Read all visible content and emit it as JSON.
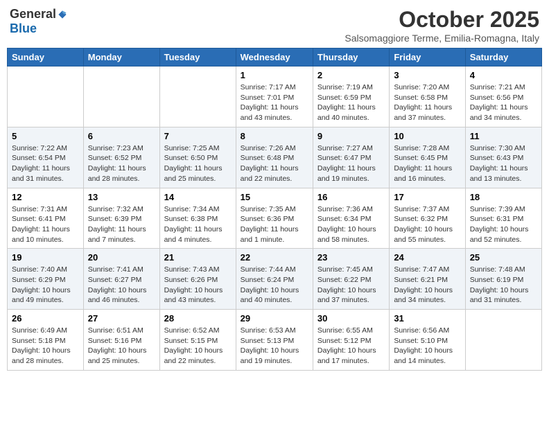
{
  "header": {
    "logo_general": "General",
    "logo_blue": "Blue",
    "month_year": "October 2025",
    "location": "Salsomaggiore Terme, Emilia-Romagna, Italy"
  },
  "days_of_week": [
    "Sunday",
    "Monday",
    "Tuesday",
    "Wednesday",
    "Thursday",
    "Friday",
    "Saturday"
  ],
  "weeks": [
    [
      {
        "day": "",
        "content": ""
      },
      {
        "day": "",
        "content": ""
      },
      {
        "day": "",
        "content": ""
      },
      {
        "day": "1",
        "content": "Sunrise: 7:17 AM\nSunset: 7:01 PM\nDaylight: 11 hours\nand 43 minutes."
      },
      {
        "day": "2",
        "content": "Sunrise: 7:19 AM\nSunset: 6:59 PM\nDaylight: 11 hours\nand 40 minutes."
      },
      {
        "day": "3",
        "content": "Sunrise: 7:20 AM\nSunset: 6:58 PM\nDaylight: 11 hours\nand 37 minutes."
      },
      {
        "day": "4",
        "content": "Sunrise: 7:21 AM\nSunset: 6:56 PM\nDaylight: 11 hours\nand 34 minutes."
      }
    ],
    [
      {
        "day": "5",
        "content": "Sunrise: 7:22 AM\nSunset: 6:54 PM\nDaylight: 11 hours\nand 31 minutes."
      },
      {
        "day": "6",
        "content": "Sunrise: 7:23 AM\nSunset: 6:52 PM\nDaylight: 11 hours\nand 28 minutes."
      },
      {
        "day": "7",
        "content": "Sunrise: 7:25 AM\nSunset: 6:50 PM\nDaylight: 11 hours\nand 25 minutes."
      },
      {
        "day": "8",
        "content": "Sunrise: 7:26 AM\nSunset: 6:48 PM\nDaylight: 11 hours\nand 22 minutes."
      },
      {
        "day": "9",
        "content": "Sunrise: 7:27 AM\nSunset: 6:47 PM\nDaylight: 11 hours\nand 19 minutes."
      },
      {
        "day": "10",
        "content": "Sunrise: 7:28 AM\nSunset: 6:45 PM\nDaylight: 11 hours\nand 16 minutes."
      },
      {
        "day": "11",
        "content": "Sunrise: 7:30 AM\nSunset: 6:43 PM\nDaylight: 11 hours\nand 13 minutes."
      }
    ],
    [
      {
        "day": "12",
        "content": "Sunrise: 7:31 AM\nSunset: 6:41 PM\nDaylight: 11 hours\nand 10 minutes."
      },
      {
        "day": "13",
        "content": "Sunrise: 7:32 AM\nSunset: 6:39 PM\nDaylight: 11 hours\nand 7 minutes."
      },
      {
        "day": "14",
        "content": "Sunrise: 7:34 AM\nSunset: 6:38 PM\nDaylight: 11 hours\nand 4 minutes."
      },
      {
        "day": "15",
        "content": "Sunrise: 7:35 AM\nSunset: 6:36 PM\nDaylight: 11 hours\nand 1 minute."
      },
      {
        "day": "16",
        "content": "Sunrise: 7:36 AM\nSunset: 6:34 PM\nDaylight: 10 hours\nand 58 minutes."
      },
      {
        "day": "17",
        "content": "Sunrise: 7:37 AM\nSunset: 6:32 PM\nDaylight: 10 hours\nand 55 minutes."
      },
      {
        "day": "18",
        "content": "Sunrise: 7:39 AM\nSunset: 6:31 PM\nDaylight: 10 hours\nand 52 minutes."
      }
    ],
    [
      {
        "day": "19",
        "content": "Sunrise: 7:40 AM\nSunset: 6:29 PM\nDaylight: 10 hours\nand 49 minutes."
      },
      {
        "day": "20",
        "content": "Sunrise: 7:41 AM\nSunset: 6:27 PM\nDaylight: 10 hours\nand 46 minutes."
      },
      {
        "day": "21",
        "content": "Sunrise: 7:43 AM\nSunset: 6:26 PM\nDaylight: 10 hours\nand 43 minutes."
      },
      {
        "day": "22",
        "content": "Sunrise: 7:44 AM\nSunset: 6:24 PM\nDaylight: 10 hours\nand 40 minutes."
      },
      {
        "day": "23",
        "content": "Sunrise: 7:45 AM\nSunset: 6:22 PM\nDaylight: 10 hours\nand 37 minutes."
      },
      {
        "day": "24",
        "content": "Sunrise: 7:47 AM\nSunset: 6:21 PM\nDaylight: 10 hours\nand 34 minutes."
      },
      {
        "day": "25",
        "content": "Sunrise: 7:48 AM\nSunset: 6:19 PM\nDaylight: 10 hours\nand 31 minutes."
      }
    ],
    [
      {
        "day": "26",
        "content": "Sunrise: 6:49 AM\nSunset: 5:18 PM\nDaylight: 10 hours\nand 28 minutes."
      },
      {
        "day": "27",
        "content": "Sunrise: 6:51 AM\nSunset: 5:16 PM\nDaylight: 10 hours\nand 25 minutes."
      },
      {
        "day": "28",
        "content": "Sunrise: 6:52 AM\nSunset: 5:15 PM\nDaylight: 10 hours\nand 22 minutes."
      },
      {
        "day": "29",
        "content": "Sunrise: 6:53 AM\nSunset: 5:13 PM\nDaylight: 10 hours\nand 19 minutes."
      },
      {
        "day": "30",
        "content": "Sunrise: 6:55 AM\nSunset: 5:12 PM\nDaylight: 10 hours\nand 17 minutes."
      },
      {
        "day": "31",
        "content": "Sunrise: 6:56 AM\nSunset: 5:10 PM\nDaylight: 10 hours\nand 14 minutes."
      },
      {
        "day": "",
        "content": ""
      }
    ]
  ]
}
